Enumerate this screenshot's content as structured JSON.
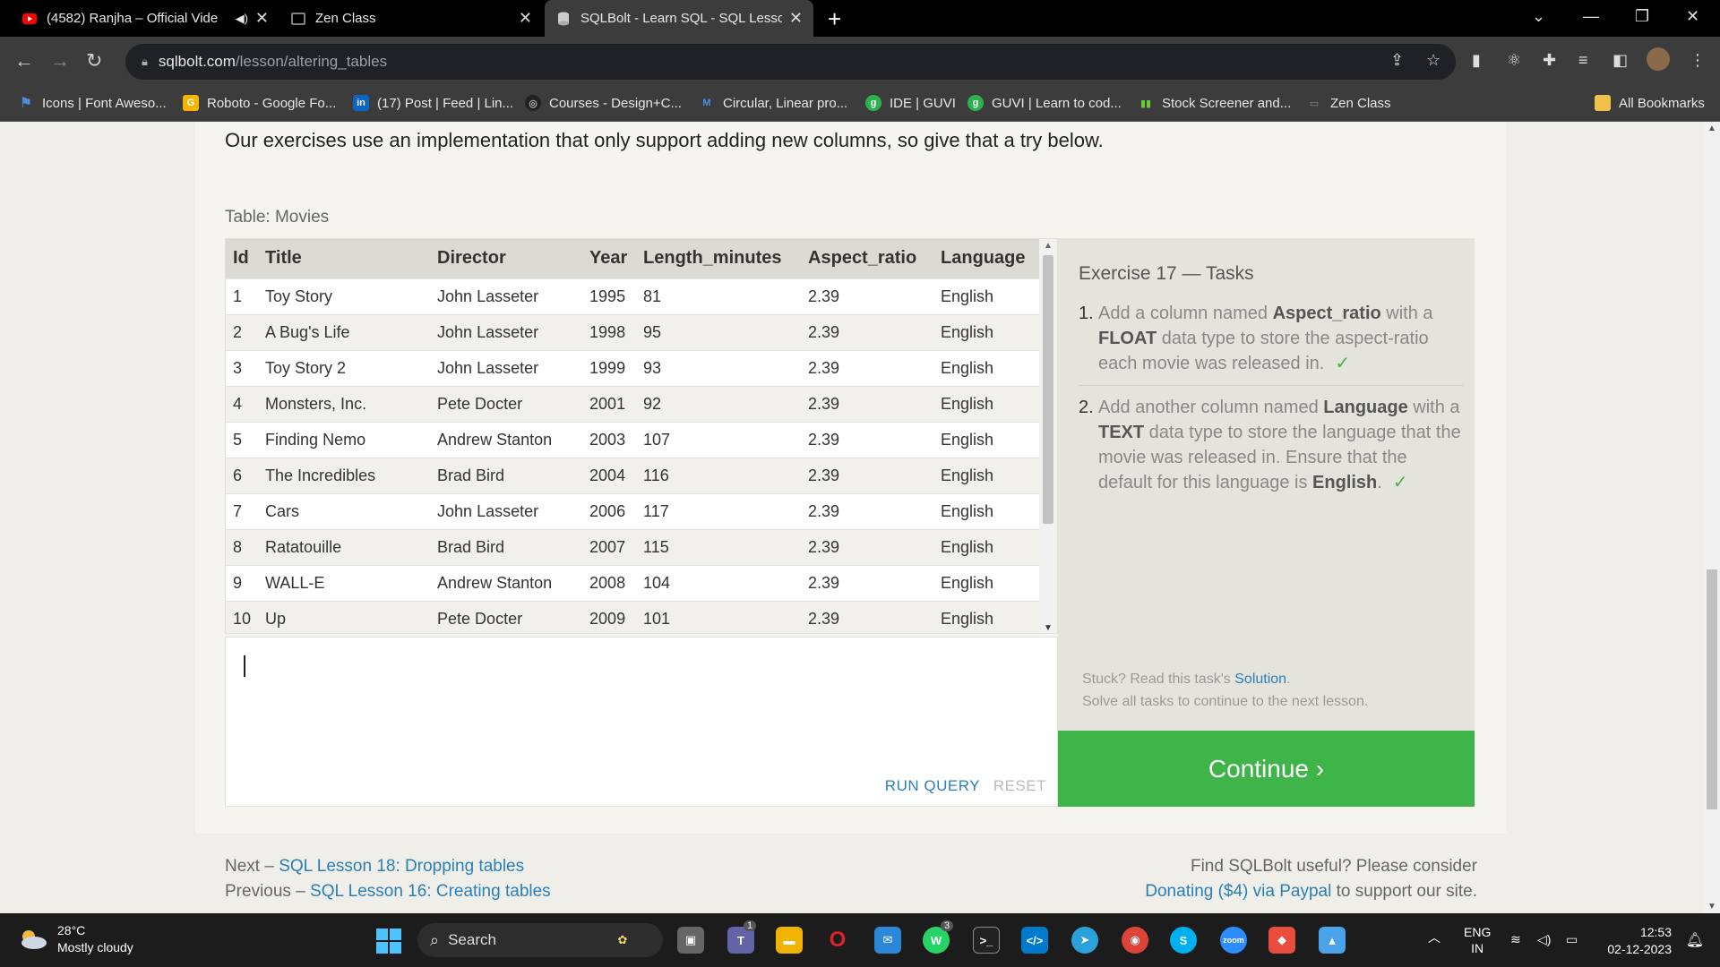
{
  "tabs": [
    {
      "label": "(4582) Ranjha – Official Vide",
      "active": false
    },
    {
      "label": "Zen Class",
      "active": false
    },
    {
      "label": "SQLBolt - Learn SQL - SQL Lesso",
      "active": true
    }
  ],
  "address": {
    "domain": "sqlbolt.com",
    "path": "/lesson/altering_tables"
  },
  "bookmarks": [
    "Icons | Font Aweso...",
    "Roboto - Google Fo...",
    "(17) Post | Feed | Lin...",
    "Courses - Design+C...",
    "Circular, Linear pro...",
    "IDE | GUVI",
    "GUVI | Learn to cod...",
    "Stock Screener and...",
    "Zen Class",
    "All Bookmarks"
  ],
  "lesson": {
    "intro": "Our exercises use an implementation that only support adding new columns, so give that a try below.",
    "table_label": "Table: Movies",
    "columns": [
      "Id",
      "Title",
      "Director",
      "Year",
      "Length_minutes",
      "Aspect_ratio",
      "Language"
    ],
    "rows": [
      [
        "1",
        "Toy Story",
        "John Lasseter",
        "1995",
        "81",
        "2.39",
        "English"
      ],
      [
        "2",
        "A Bug's Life",
        "John Lasseter",
        "1998",
        "95",
        "2.39",
        "English"
      ],
      [
        "3",
        "Toy Story 2",
        "John Lasseter",
        "1999",
        "93",
        "2.39",
        "English"
      ],
      [
        "4",
        "Monsters, Inc.",
        "Pete Docter",
        "2001",
        "92",
        "2.39",
        "English"
      ],
      [
        "5",
        "Finding Nemo",
        "Andrew Stanton",
        "2003",
        "107",
        "2.39",
        "English"
      ],
      [
        "6",
        "The Incredibles",
        "Brad Bird",
        "2004",
        "116",
        "2.39",
        "English"
      ],
      [
        "7",
        "Cars",
        "John Lasseter",
        "2006",
        "117",
        "2.39",
        "English"
      ],
      [
        "8",
        "Ratatouille",
        "Brad Bird",
        "2007",
        "115",
        "2.39",
        "English"
      ],
      [
        "9",
        "WALL-E",
        "Andrew Stanton",
        "2008",
        "104",
        "2.39",
        "English"
      ],
      [
        "10",
        "Up",
        "Pete Docter",
        "2009",
        "101",
        "2.39",
        "English"
      ]
    ],
    "run_label": "RUN QUERY",
    "reset_label": "RESET"
  },
  "exercise": {
    "title": "Exercise 17 — Tasks",
    "task1": {
      "num": "1.",
      "a": "Add a column named ",
      "b1": "Aspect_ratio",
      "c": " with a ",
      "b2": "FLOAT",
      "d": " data type to store the aspect-ratio each movie was released in.",
      "check": "✓"
    },
    "task2": {
      "num": "2.",
      "a": "Add another column named ",
      "b1": "Language",
      "c": " with a ",
      "b2": "TEXT",
      "d": " data type to store the language that the movie was released in. Ensure that the default for this language is ",
      "b3": "English",
      "e": ".",
      "check": "✓"
    },
    "stuck_prefix": "Stuck? Read this task's ",
    "solution_label": "Solution",
    "stuck_suffix": ".",
    "solve_all": "Solve all tasks to continue to the next lesson.",
    "continue_label": "Continue ›"
  },
  "footer": {
    "next_prefix": "Next – ",
    "next_link": "SQL Lesson 18: Dropping tables",
    "prev_prefix": "Previous – ",
    "prev_link": "SQL Lesson 16: Creating tables",
    "useful": "Find SQLBolt useful? Please consider",
    "donate_link": "Donating ($4) via Paypal",
    "donate_suffix": " to support our site."
  },
  "taskbar": {
    "temp": "28°C",
    "weather": "Mostly cloudy",
    "search": "Search",
    "lang1": "ENG",
    "lang2": "IN",
    "time": "12:53",
    "date": "02-12-2023",
    "badge_teams": "1",
    "badge_whatsapp": "3"
  },
  "colors": {
    "accent_green": "#3fb449",
    "link_blue": "#2980b9"
  }
}
